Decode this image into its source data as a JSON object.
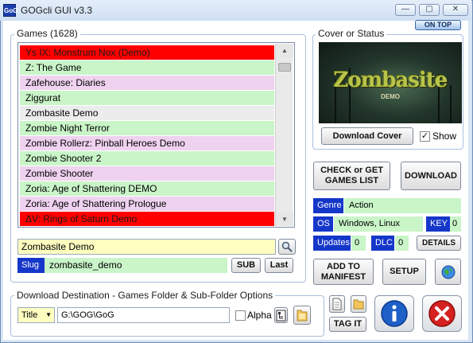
{
  "window": {
    "title": "GOGcli GUI v3.3",
    "app_icon": "GoG",
    "minimize": "—",
    "maximize": "▢",
    "close": "✕"
  },
  "on_top": "ON TOP",
  "games": {
    "group_label": "Games  (1628)",
    "items": [
      {
        "label": "Ys IX: Monstrum Nox (Demo)",
        "color": "#ff0000"
      },
      {
        "label": "Z: The Game",
        "color": "#c9f5c8"
      },
      {
        "label": "Zafehouse: Diaries",
        "color": "#efd2ef"
      },
      {
        "label": "Ziggurat",
        "color": "#c9f5c8"
      },
      {
        "label": "Zombasite Demo",
        "color": "#ececec"
      },
      {
        "label": "Zombie Night Terror",
        "color": "#c9f5c8"
      },
      {
        "label": "Zombie Rollerz: Pinball Heroes Demo",
        "color": "#efd2ef"
      },
      {
        "label": "Zombie Shooter 2",
        "color": "#c9f5c8"
      },
      {
        "label": "Zombie Shooter",
        "color": "#efd2ef"
      },
      {
        "label": "Zoria: Age of Shattering DEMO",
        "color": "#c9f5c8"
      },
      {
        "label": "Zoria: Age of Shattering Prologue",
        "color": "#efd2ef"
      },
      {
        "label": "ΔV: Rings of Saturn Demo",
        "color": "#ff0000"
      }
    ],
    "selected_title": "Zombasite Demo",
    "slug_label": "Slug",
    "slug_value": "zombasite_demo",
    "sub_button": "SUB",
    "last_button": "Last"
  },
  "cover": {
    "group_label": "Cover or Status",
    "image_title": "Zombasite",
    "image_subtitle": "DEMO",
    "download_cover_button": "Download Cover",
    "show_checkbox_label": "Show",
    "show_checked": "✓"
  },
  "actions": {
    "check_get_games": "CHECK or GET GAMES LIST",
    "download": "DOWNLOAD",
    "add_to_manifest": "ADD TO MANIFEST",
    "setup": "SETUP",
    "details": "DETAILS",
    "tag_it": "TAG IT"
  },
  "info": {
    "genre_label": "Genre",
    "genre_value": "Action",
    "os_label": "OS",
    "os_value": "Windows, Linux",
    "key_label": "KEY",
    "key_value": "0",
    "updates_label": "Updates",
    "updates_value": "0",
    "dlc_label": "DLC",
    "dlc_value": "0"
  },
  "destination": {
    "group_label": "Download Destination - Games Folder & Sub-Folder Options",
    "subfolder_select": "Title",
    "path_value": "G:\\GOG\\GoG",
    "alpha_label": "Alpha"
  },
  "colors": {
    "blue_label": "#1537c9",
    "green_value": "#c9f5c8",
    "red_item": "#ff0000",
    "pink_item": "#efd2ef",
    "yellow_input": "#fefec0"
  }
}
